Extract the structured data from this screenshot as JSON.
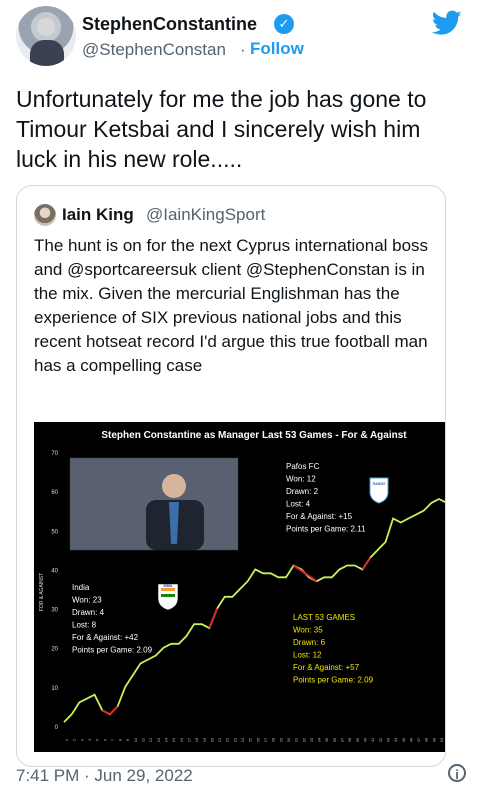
{
  "author": {
    "name": "StephenConstantine",
    "handle": "@StephenConstan",
    "separator": "·",
    "follow_label": "Follow"
  },
  "tweet": {
    "text": "Unfortunately for me the job has gone to Timour Ketsbai and I sincerely wish him luck in his new role....."
  },
  "quoted": {
    "name": "Iain King",
    "handle": "@IainKingSport",
    "text": "The hunt is on for the next Cyprus international boss and @sportcareersuk client @StephenConstan is in the mix. Given the mercurial Englishman has the experience of SIX previous national jobs and this recent hotseat record I'd argue this true football man has a compelling case"
  },
  "timestamp": "7:41 PM · Jun 29, 2022",
  "colors": {
    "accent": "#1d9bf0",
    "line": "#c7f25a",
    "label_yellow": "#f3e400"
  },
  "chart_data": {
    "type": "line",
    "title": "Stephen Constantine as Manager Last 53 Games - For & Against",
    "ylabel": "FOR & AGAINST",
    "ylim": [
      0,
      70
    ],
    "yticks": [
      0,
      10,
      20,
      30,
      40,
      50,
      60,
      70
    ],
    "x": [
      1,
      2,
      3,
      4,
      5,
      6,
      7,
      8,
      9,
      10,
      11,
      12,
      13,
      14,
      15,
      16,
      17,
      18,
      19,
      20,
      21,
      22,
      23,
      24,
      25,
      26,
      27,
      28,
      29,
      30,
      31,
      32,
      33,
      34,
      35,
      36,
      37,
      38,
      39,
      40,
      41,
      42,
      43,
      44,
      45,
      46,
      47,
      48,
      49,
      50,
      51,
      52,
      53
    ],
    "values": [
      1,
      3,
      6,
      7,
      8,
      4,
      3,
      5,
      10,
      13,
      16,
      17,
      18,
      20,
      21,
      21,
      23,
      26,
      26,
      25,
      30,
      33,
      33,
      35,
      37,
      40,
      39,
      39,
      38,
      38,
      41,
      40,
      38,
      37,
      38,
      38,
      40,
      41,
      41,
      40,
      43,
      45,
      47,
      53,
      52,
      53,
      54,
      55,
      57,
      58,
      57,
      57,
      57
    ],
    "series_color": "#c7f25a",
    "annotations": {
      "pafos": [
        "Pafos FC",
        "Won: 12",
        "Drawn: 2",
        "Lost: 4",
        "For & Against: +15",
        "Points per Game: 2.11"
      ],
      "india": [
        "India",
        "Won: 23",
        "Drawn: 4",
        "Lost: 8",
        "For & Against: +42",
        "Points per Game: 2.09"
      ],
      "last53": [
        "LAST 53 GAMES",
        "Won: 35",
        "Drawn: 6",
        "Lost: 12",
        "For & Against: +57",
        "Points per Game: 2.09"
      ]
    },
    "badges": {
      "pafos": "ΠΑΦΟΣ",
      "india": "INDIA"
    }
  }
}
